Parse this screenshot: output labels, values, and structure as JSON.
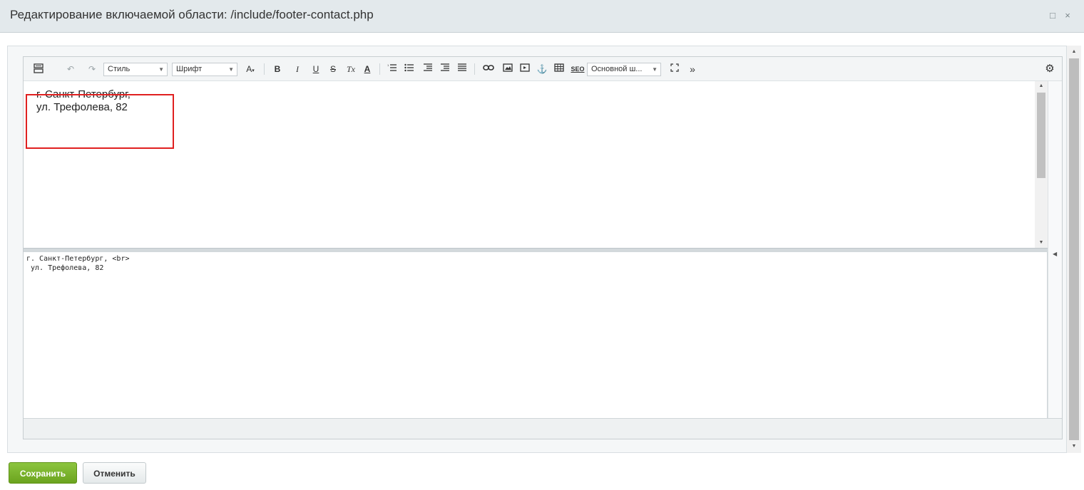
{
  "window": {
    "title": "Редактирование включаемой области: /include/footer-contact.php",
    "maximize_icon": "□",
    "close_icon": "×"
  },
  "toolbar": {
    "style_select": "Стиль",
    "font_select": "Шрифт",
    "template_select": "Основной ш...",
    "bold": "B",
    "italic": "I",
    "underline": "U",
    "strike": "S",
    "remove_format": "Tx",
    "font_color": "A",
    "font_size": "A",
    "seo": "SEO",
    "more": "»"
  },
  "wysiwyg": {
    "lines": [
      "г. Санкт-Петербург,",
      "ул. Трефолева, 82"
    ]
  },
  "source": {
    "lines": [
      "г. Санкт-Петербург, <br>",
      " ул. Трефолева, 82"
    ]
  },
  "buttons": {
    "save": "Сохранить",
    "cancel": "Отменить"
  },
  "colors": {
    "accent_green": "#7ab42c",
    "highlight_red": "#e02020",
    "titlebar_bg": "#e3e9ec"
  }
}
